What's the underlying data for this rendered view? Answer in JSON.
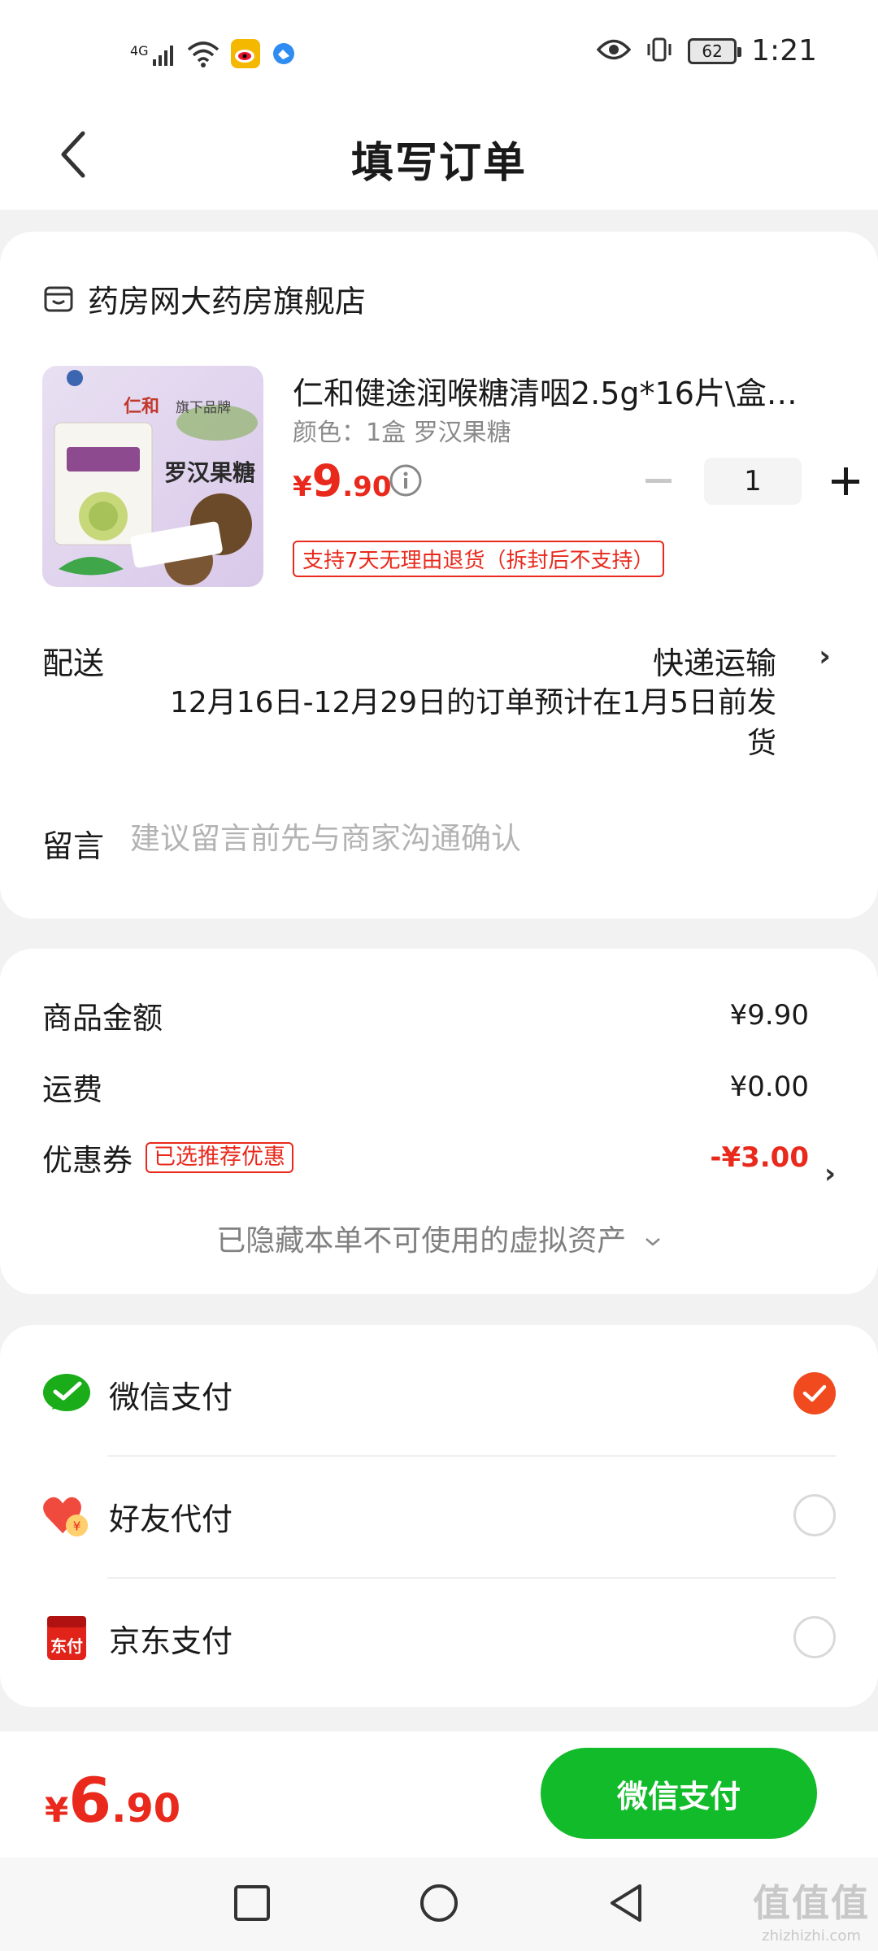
{
  "status_bar": {
    "network": "4G",
    "battery": "62",
    "time": "1:21"
  },
  "header": {
    "title": "填写订单"
  },
  "store": {
    "name": "药房网大药房旗舰店"
  },
  "product": {
    "title": "仁和健途润喉糖清咽2.5g*16片\\盒…",
    "spec": "颜色：1盒 罗汉果糖",
    "price_symbol": "¥",
    "price_int": "9",
    "price_dec": ".90",
    "quantity": "1",
    "return_policy": "支持7天无理由退货（拆封后不支持）",
    "image_brand": "仁和",
    "image_tagline": "旗下品牌",
    "image_name": "罗汉果糖"
  },
  "delivery": {
    "label": "配送",
    "method": "快递运输",
    "note": "12月16日-12月29日的订单预计在1月5日前发货"
  },
  "message": {
    "label": "留言",
    "placeholder": "建议留言前先与商家沟通确认"
  },
  "summary": {
    "goods_label": "商品金额",
    "goods_value": "¥9.90",
    "shipping_label": "运费",
    "shipping_value": "¥0.00",
    "coupon_label": "优惠券",
    "coupon_badge": "已选推荐优惠",
    "coupon_value": "-¥3.00",
    "hidden_assets": "已隐藏本单不可使用的虚拟资产"
  },
  "payment": {
    "options": [
      {
        "label": "微信支付",
        "icon": "wechat-pay-icon",
        "selected": true
      },
      {
        "label": "好友代付",
        "icon": "friend-pay-icon",
        "selected": false
      },
      {
        "label": "京东支付",
        "icon": "jd-pay-icon",
        "selected": false
      }
    ]
  },
  "bottom": {
    "total_symbol": "¥",
    "total_int": "6",
    "total_dec": ".90",
    "pay_button": "微信支付"
  },
  "watermark": {
    "text": "值值值",
    "url": "zhizhizhi.com"
  },
  "colors": {
    "accent_red": "#e8291c",
    "wechat_green": "#12bb2a",
    "check_orange": "#f04a1e"
  }
}
